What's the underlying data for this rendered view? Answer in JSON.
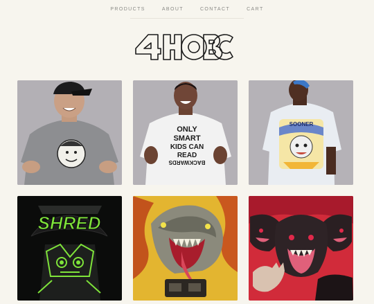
{
  "nav": {
    "items": [
      {
        "label": "PRODUCTS"
      },
      {
        "label": "ABOUT"
      },
      {
        "label": "CONTACT"
      },
      {
        "label": "CART"
      }
    ]
  },
  "logo": {
    "text": "4HOBC"
  },
  "colors": {
    "background": "#f7f5ee",
    "nav_text": "#8a8a86",
    "neon_green": "#7fe43a"
  },
  "products": [
    {
      "name": "shirt-1"
    },
    {
      "name": "shirt-2",
      "shirt_text": [
        "ONLY",
        "SMART",
        "KIDS CAN",
        "READ",
        "BACKWARDS"
      ]
    },
    {
      "name": "shirt-3",
      "shirt_text": "SOONER"
    },
    {
      "name": "shirt-4",
      "art_text": "SHRED"
    },
    {
      "name": "shirt-5"
    },
    {
      "name": "shirt-6"
    }
  ]
}
